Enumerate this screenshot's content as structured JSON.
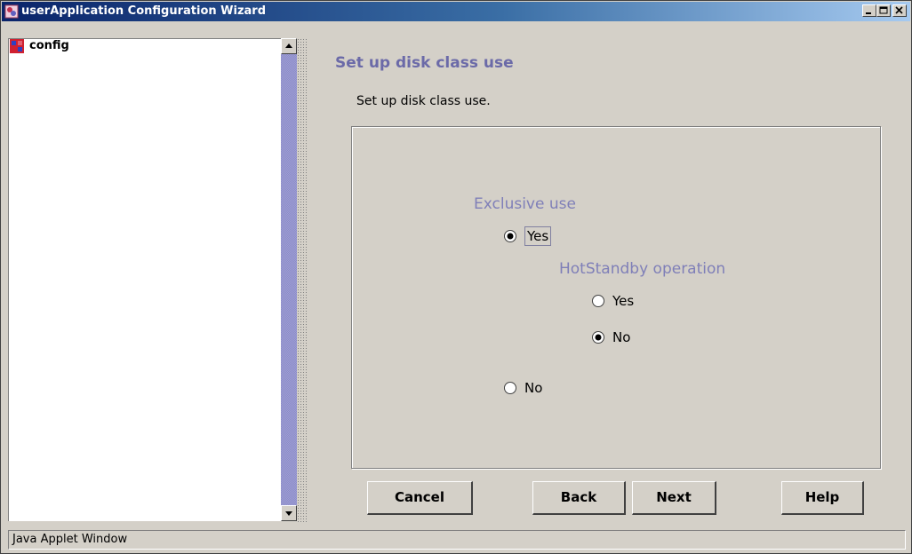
{
  "window": {
    "title": "userApplication Configuration Wizard"
  },
  "tree": {
    "root_label": "config"
  },
  "main": {
    "title": "Set up disk class use",
    "description": "Set up disk class use.",
    "exclusive_use": {
      "label": "Exclusive use",
      "selected": "Yes",
      "options": {
        "yes": "Yes",
        "no": "No"
      },
      "hotstandby": {
        "label": "HotStandby operation",
        "selected": "No",
        "options": {
          "yes": "Yes",
          "no": "No"
        }
      }
    }
  },
  "buttons": {
    "cancel": "Cancel",
    "back": "Back",
    "next": "Next",
    "help": "Help"
  },
  "status": {
    "text": "Java Applet Window"
  },
  "colors": {
    "title_gradient_start": "#0a246a",
    "accent_text": "#6b6aa8",
    "window_bg": "#d4d0c8"
  }
}
